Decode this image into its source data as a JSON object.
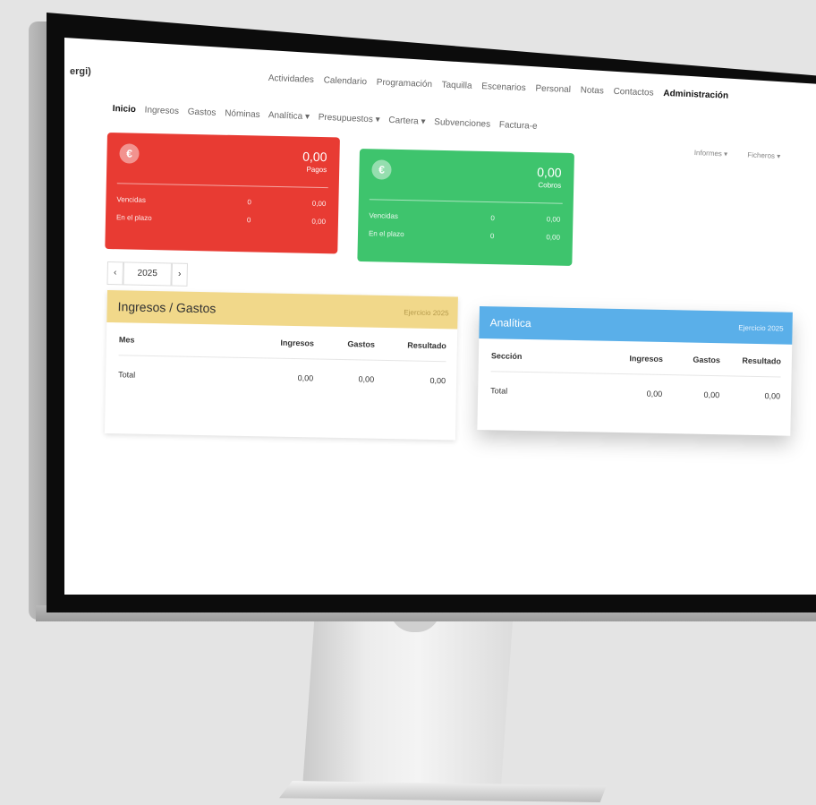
{
  "app": {
    "brand": "ergi)"
  },
  "topnav": [
    "Actividades",
    "Calendario",
    "Programación",
    "Taquilla",
    "Escenarios",
    "Personal",
    "Notas",
    "Contactos",
    "Administración"
  ],
  "subnav": {
    "items": [
      {
        "label": "Inicio",
        "active": true
      },
      {
        "label": "Ingresos"
      },
      {
        "label": "Gastos"
      },
      {
        "label": "Nóminas"
      },
      {
        "label": "Analítica ▾"
      },
      {
        "label": "Presupuestos ▾"
      },
      {
        "label": "Cartera ▾"
      },
      {
        "label": "Subvenciones"
      },
      {
        "label": "Factura-e"
      }
    ],
    "right": [
      "Informes ▾",
      "Ficheros ▾"
    ]
  },
  "cards": {
    "pagos": {
      "icon": "euro-icon",
      "amount": "0,00",
      "label": "Pagos",
      "color": "#e83b33",
      "rows": [
        {
          "label": "Vencidas",
          "count": "0",
          "value": "0,00"
        },
        {
          "label": "En el plazo",
          "count": "0",
          "value": "0,00"
        }
      ]
    },
    "cobros": {
      "icon": "euro-icon",
      "amount": "0,00",
      "label": "Cobros",
      "color": "#3ec46d",
      "rows": [
        {
          "label": "Vencidas",
          "count": "0",
          "value": "0,00"
        },
        {
          "label": "En el plazo",
          "count": "0",
          "value": "0,00"
        }
      ]
    }
  },
  "year": {
    "value": "2025",
    "prev": "‹",
    "next": "›"
  },
  "ingresos_gastos": {
    "title": "Ingresos / Gastos",
    "exercise": "Ejercicio 2025",
    "color": "#f1d88a",
    "columns": [
      "Mes",
      "Ingresos",
      "Gastos",
      "Resultado"
    ],
    "rows": [
      [
        "Total",
        "0,00",
        "0,00",
        "0,00"
      ]
    ]
  },
  "analitica": {
    "title": "Analítica",
    "exercise": "Ejercicio 2025",
    "color": "#5aafe9",
    "columns": [
      "Sección",
      "Ingresos",
      "Gastos",
      "Resultado"
    ],
    "rows": [
      [
        "Total",
        "0,00",
        "0,00",
        "0,00"
      ]
    ]
  }
}
